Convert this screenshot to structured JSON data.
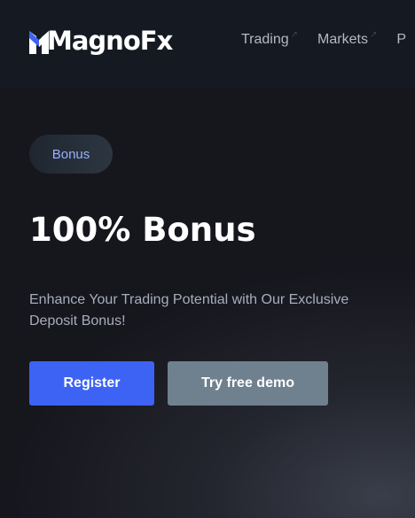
{
  "header": {
    "logo_text": "MagnoFx",
    "nav": [
      {
        "label": "Trading"
      },
      {
        "label": "Markets"
      },
      {
        "label": "P"
      }
    ]
  },
  "hero": {
    "badge": "Bonus",
    "title": "100% Bonus",
    "subtitle": "Enhance Your Trading Potential with Our Exclusive Deposit Bonus!",
    "register_label": "Register",
    "demo_label": "Try free demo"
  },
  "colors": {
    "brand_blue": "#3d63f4",
    "demo_gray": "#6f808e",
    "badge_text": "#9ab0ff",
    "header_bg": "#151a22"
  },
  "icons": {
    "logo_mark": "magnofx-logo-icon",
    "nav_arrow": "arrow-up-right-icon"
  }
}
